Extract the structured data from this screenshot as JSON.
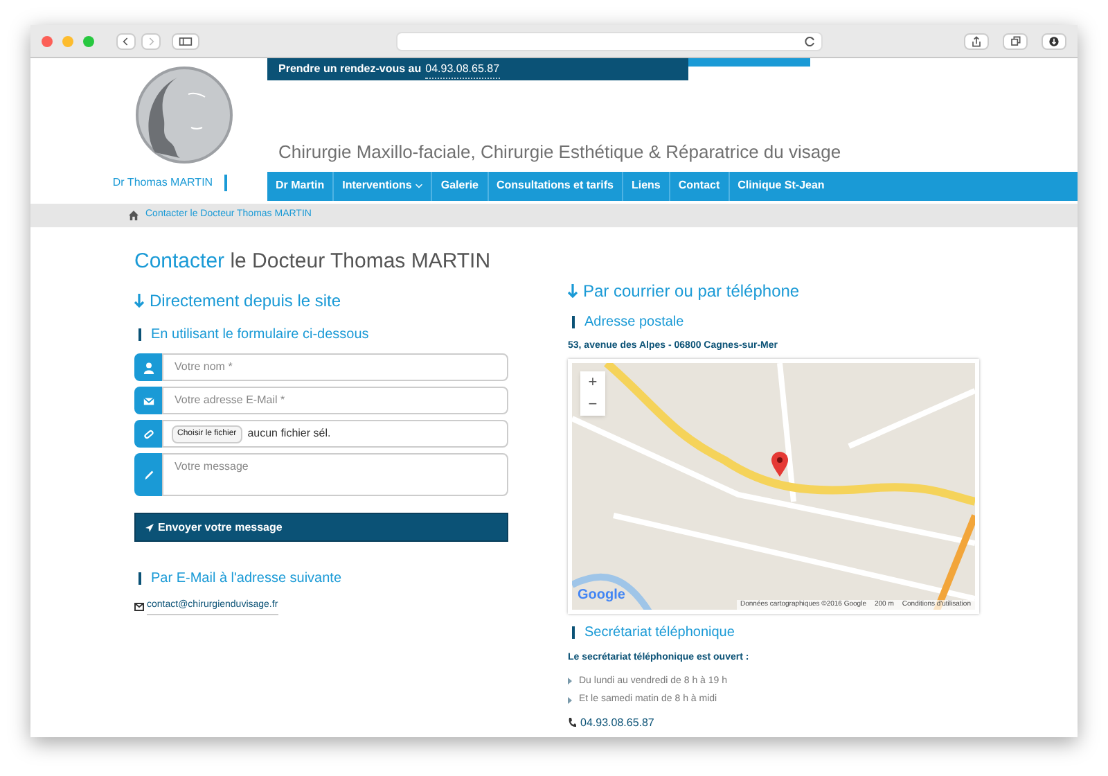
{
  "topbar": {
    "text": "Prendre un rendez-vous au",
    "phone": "04.93.08.65.87"
  },
  "logo": {
    "name": "Dr Thomas MARTIN"
  },
  "tagline": "Chirurgie Maxillo-faciale, Chirurgie Esthétique & Réparatrice du visage",
  "nav": [
    {
      "label": "Dr Martin",
      "dropdown": false
    },
    {
      "label": "Interventions",
      "dropdown": true
    },
    {
      "label": "Galerie",
      "dropdown": false
    },
    {
      "label": "Consultations et tarifs",
      "dropdown": false
    },
    {
      "label": "Liens",
      "dropdown": false
    },
    {
      "label": "Contact",
      "dropdown": false
    },
    {
      "label": "Clinique St-Jean",
      "dropdown": false
    }
  ],
  "breadcrumb": [
    "Contacter le Docteur Thomas MARTIN"
  ],
  "heading": {
    "accent": "Contacter",
    "rest": "le Docteur Thomas MARTIN"
  },
  "left": {
    "title": "Directement depuis le site",
    "form_title": "En utilisant le formulaire ci-dessous",
    "fields": [
      {
        "kind": "text",
        "placeholder": "Votre nom *"
      },
      {
        "kind": "text",
        "placeholder": "Votre adresse E-Mail *"
      },
      {
        "kind": "file",
        "button": "Choisir le fichier",
        "value": "aucun fichier sél."
      },
      {
        "kind": "textarea",
        "placeholder": "Votre message"
      }
    ],
    "submit": "Envoyer votre message",
    "email_title": "Par E-Mail à l'adresse suivante",
    "email": "contact@chirurgienduvisage.fr"
  },
  "right": {
    "title": "Par courrier ou par téléphone",
    "address_title": "Adresse postale",
    "address": "53, avenue des Alpes - 06800 Cagnes-sur-Mer",
    "map": {
      "zoom_in": "+",
      "zoom_out": "−",
      "logo": "Google",
      "attribution": "Données cartographiques ©2016 Google",
      "scale": "200 m",
      "terms": "Conditions d'utilisation"
    },
    "phone_title": "Secrétariat téléphonique",
    "phone_intro": "Le secrétariat téléphonique est ouvert :",
    "hours": [
      "Du lundi au vendredi de 8 h à 19 h",
      "Et le samedi matin de 8 h à midi"
    ],
    "phone": "04.93.08.65.87"
  }
}
